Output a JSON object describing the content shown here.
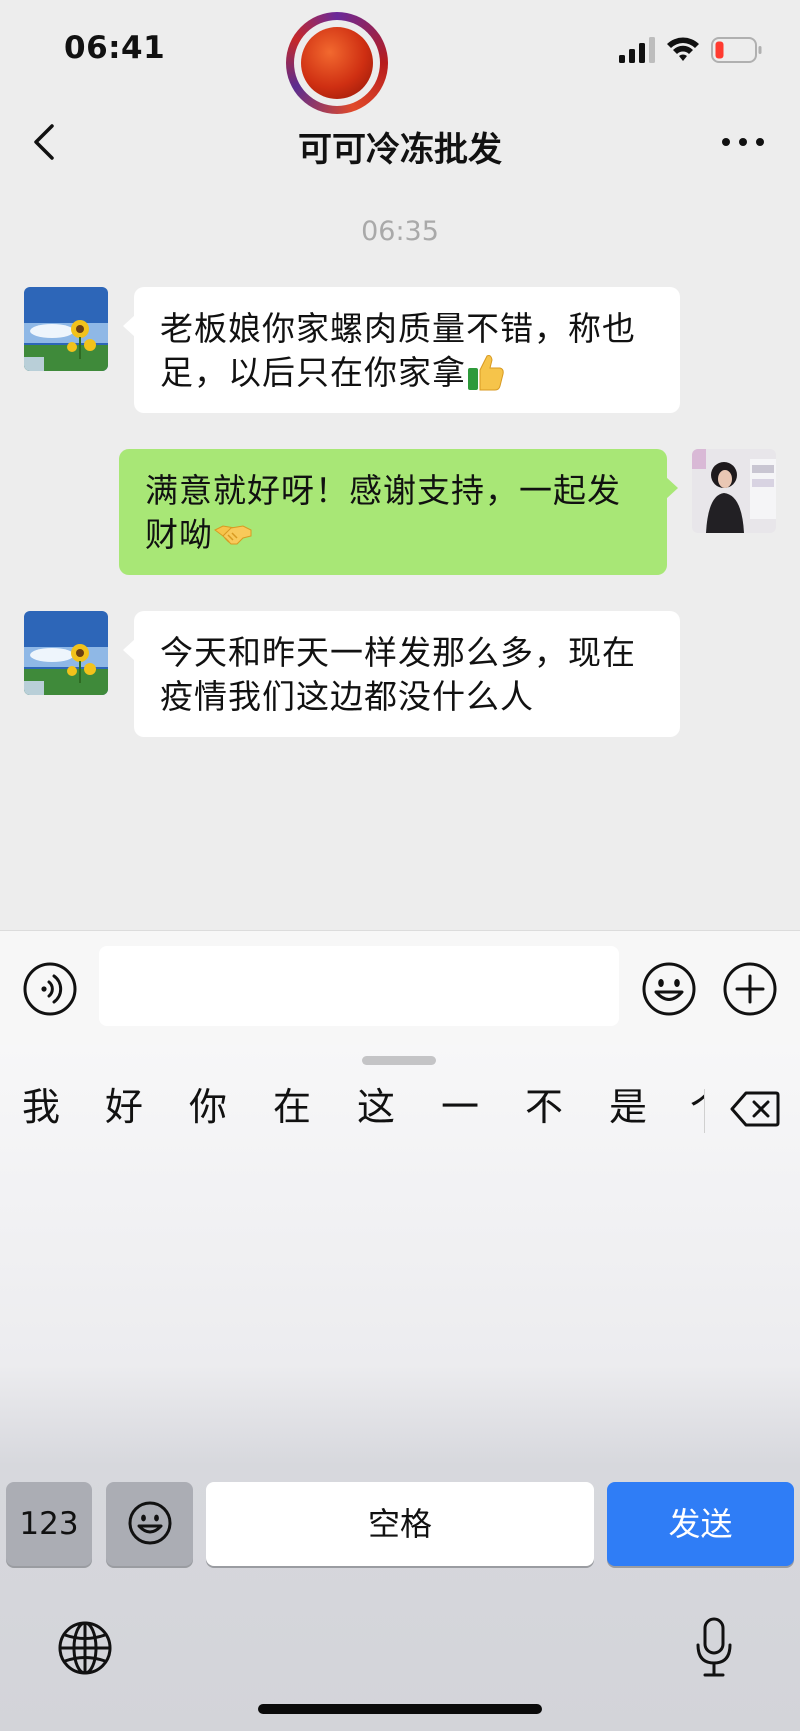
{
  "status_bar": {
    "time": "06:41",
    "battery_color": "#ff3b30"
  },
  "header": {
    "title": "可可冷冻批发",
    "back_icon": "chevron-left-icon",
    "more_icon": "more-dots-icon"
  },
  "chat": {
    "timestamp": "06:35",
    "messages": [
      {
        "side": "left",
        "text": "老板娘你家螺肉质量不错，称也足，以后只在你家拿",
        "emoji": "thumbs-up"
      },
      {
        "side": "right",
        "text": "满意就好呀！感谢支持，一起发财呦",
        "emoji": "handshake"
      },
      {
        "side": "left",
        "text": "今天和昨天一样发那么多，现在疫情我们这边都没什么人",
        "emoji": ""
      }
    ]
  },
  "input_bar": {
    "value": "",
    "voice_icon": "voice-icon",
    "emoji_icon": "emoji-icon",
    "plus_icon": "plus-icon"
  },
  "keyboard": {
    "candidates": [
      "我",
      "好",
      "你",
      "在",
      "这",
      "一",
      "不",
      "是",
      "个"
    ],
    "key_123": "123",
    "key_space": "空格",
    "key_send": "发送",
    "send_color": "#2f7df6"
  },
  "colors": {
    "background": "#ededed",
    "bubble_self": "#a8e776",
    "bubble_other": "#ffffff"
  }
}
